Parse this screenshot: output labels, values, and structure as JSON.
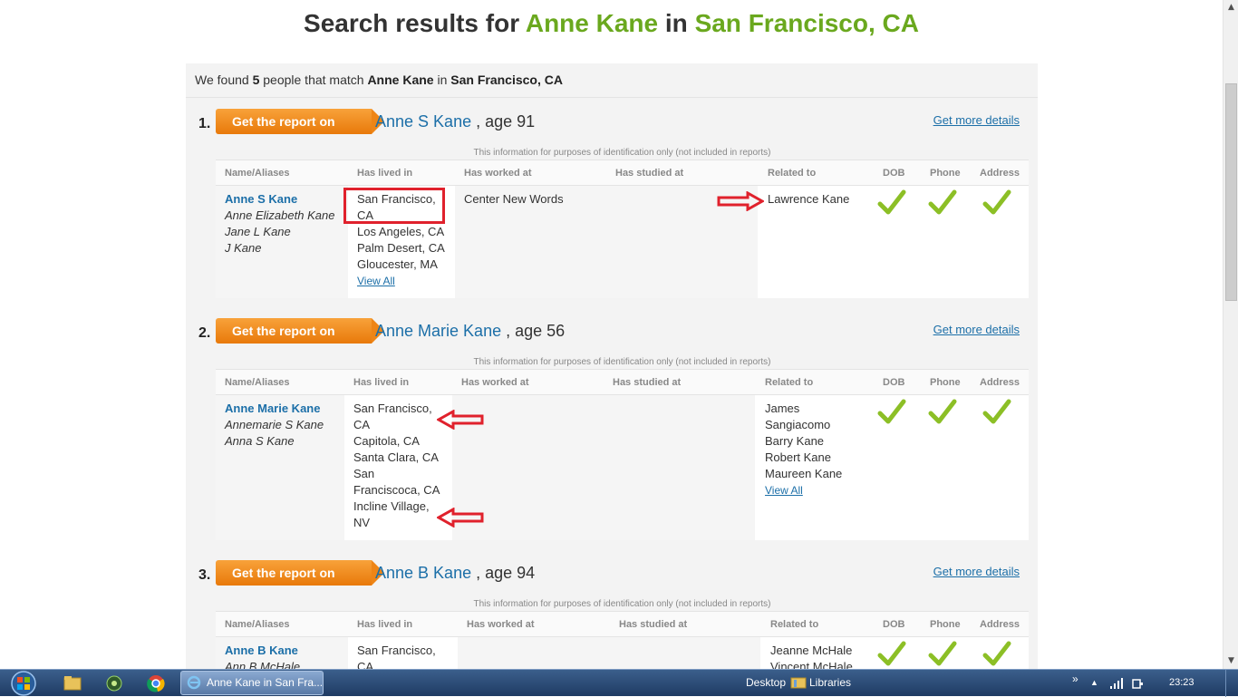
{
  "headline": {
    "prefix": "Search results for ",
    "name": "Anne Kane",
    "mid": " in ",
    "location": "San Francisco, CA"
  },
  "summary": {
    "pre": "We found ",
    "count": "5",
    "mid1": " people that match ",
    "name": "Anne Kane",
    "mid2": " in ",
    "location": "San Francisco, CA"
  },
  "button_label": "Get the report on",
  "more_label": "Get more details",
  "info_text": "This information for purposes of identification only (not included in reports)",
  "columns": [
    "Name/Aliases",
    "Has lived in",
    "Has worked at",
    "Has studied at",
    "Related to",
    "DOB",
    "Phone",
    "Address"
  ],
  "view_all": "View All",
  "results": [
    {
      "number": "1.",
      "name": "Anne S Kane",
      "age_text": " , age 91",
      "primary": "Anne S Kane",
      "aliases": [
        "Anne Elizabeth Kane",
        "Jane L Kane",
        "J Kane"
      ],
      "lived": [
        "San Francisco,",
        "CA",
        "Los Angeles, CA",
        "Palm Desert, CA",
        "Gloucester, MA"
      ],
      "worked": [
        "Center New Words"
      ],
      "studied": [],
      "related": [
        "Lawrence Kane"
      ]
    },
    {
      "number": "2.",
      "name": "Anne Marie Kane",
      "age_text": " , age 56",
      "primary": "Anne Marie Kane",
      "aliases": [
        "Annemarie S Kane",
        "Anna S Kane"
      ],
      "lived": [
        "San Francisco,",
        "CA",
        "Capitola, CA",
        "Santa Clara, CA",
        "San",
        "Franciscoca, CA",
        "Incline Village,",
        "NV"
      ],
      "worked": [],
      "studied": [],
      "related": [
        "James",
        "Sangiacomo",
        "Barry Kane",
        "Robert Kane",
        "Maureen Kane"
      ]
    },
    {
      "number": "3.",
      "name": "Anne B Kane",
      "age_text": " , age 94",
      "primary": "Anne B Kane",
      "aliases": [
        "Ann B McHale"
      ],
      "lived": [
        "San Francisco,",
        "CA"
      ],
      "worked": [],
      "studied": [],
      "related": [
        "Jeanne McHale",
        "Vincent McHale"
      ]
    }
  ],
  "taskbar": {
    "task_label": "Anne Kane in San Fra...",
    "desktop": "Desktop",
    "libraries": "Libraries",
    "overflow": "»",
    "clock": "23:23"
  },
  "colors": {
    "accent_green": "#6aa81e",
    "link_blue": "#1c6fa8",
    "button_orange": "#f08a1c",
    "check_green": "#8cbf26",
    "annotation_red": "#e0212c"
  }
}
